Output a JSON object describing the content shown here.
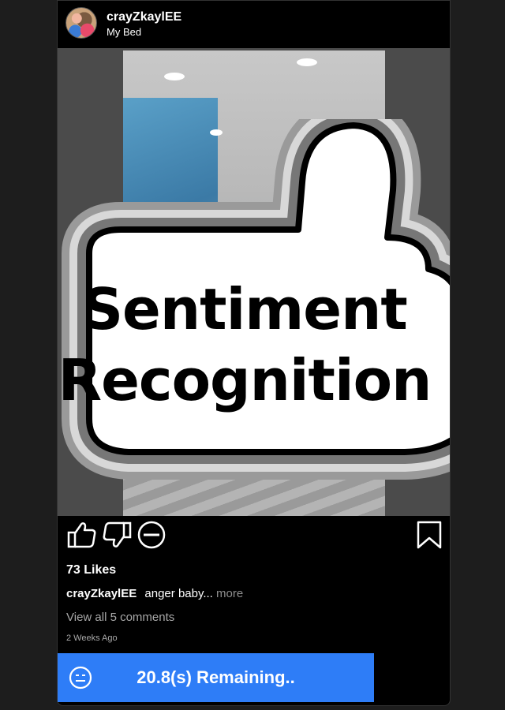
{
  "post": {
    "username": "crayZkaylEE",
    "location": "My Bed",
    "likes": "73 Likes",
    "caption_user": "crayZkaylEE",
    "caption_text": "anger baby...",
    "caption_more": "more",
    "view_comments": "View all 5 comments",
    "time_ago": "2 Weeks Ago"
  },
  "overlay": {
    "line1": "Sentiment",
    "line2": "Recognition"
  },
  "timer": {
    "label": "20.8(s) Remaining..",
    "color": "#2e7df7"
  },
  "icons": {
    "like": "thumbs-up-icon",
    "dislike": "thumbs-down-icon",
    "neutral": "minus-circle-icon",
    "save": "bookmark-icon",
    "timer": "neutral-face-icon"
  }
}
